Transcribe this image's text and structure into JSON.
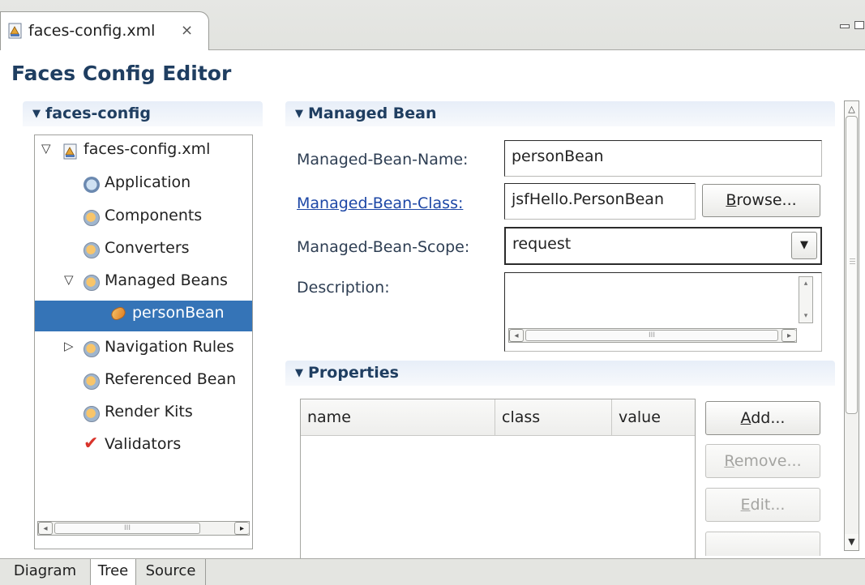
{
  "tab": {
    "title": "faces-config.xml",
    "close_glyph": "⨯",
    "icon": "xml-file-icon"
  },
  "editor": {
    "title": "Faces Config Editor"
  },
  "tree_section": {
    "title": "faces-config",
    "root": "faces-config.xml",
    "items": [
      {
        "label": "Application",
        "icon": "application-icon"
      },
      {
        "label": "Components",
        "icon": "components-icon"
      },
      {
        "label": "Converters",
        "icon": "converters-icon"
      },
      {
        "label": "Managed Beans",
        "icon": "managed-beans-icon",
        "expanded": true
      },
      {
        "label": "personBean",
        "icon": "bean-icon",
        "selected": true
      },
      {
        "label": "Navigation Rules",
        "icon": "navigation-rules-icon",
        "expanded": false
      },
      {
        "label": "Referenced Bean",
        "icon": "referenced-bean-icon"
      },
      {
        "label": "Render Kits",
        "icon": "render-kits-icon"
      },
      {
        "label": "Validators",
        "icon": "validators-icon"
      }
    ]
  },
  "managed_bean": {
    "title": "Managed Bean",
    "name_label": "Managed-Bean-Name:",
    "name_value": "personBean",
    "class_label": "Managed-Bean-Class:",
    "class_value": "jsfHello.PersonBean",
    "browse_label_rest": "rowse...",
    "browse_mnemonic": "B",
    "scope_label": "Managed-Bean-Scope:",
    "scope_value": "request",
    "description_label": "Description:",
    "description_value": ""
  },
  "properties": {
    "title": "Properties",
    "columns": [
      "name",
      "class",
      "value"
    ],
    "rows": [],
    "add": {
      "mnemonic": "A",
      "rest": "dd..."
    },
    "remove": {
      "mnemonic": "R",
      "rest": "emove..."
    },
    "edit": {
      "mnemonic": "E",
      "rest": "dit..."
    }
  },
  "page_tabs": [
    "Diagram",
    "Tree",
    "Source"
  ],
  "active_page_tab": "Tree",
  "colors": {
    "selection": "#3574b7",
    "header_text": "#1f3e61",
    "link": "#1d47a6"
  }
}
